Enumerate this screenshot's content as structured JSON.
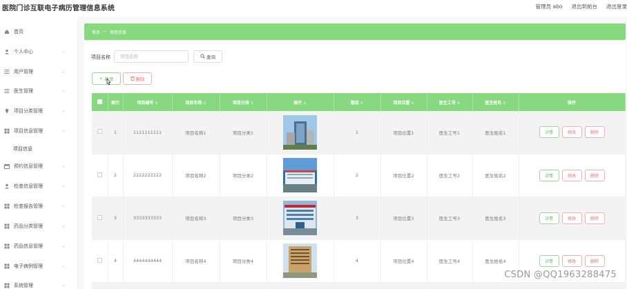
{
  "header": {
    "title": "医院门诊互联电子病历管理信息系统",
    "admin_label": "管理员 abo",
    "back_front_label": "退出到前台",
    "logout_label": "退出登录"
  },
  "sidebar": {
    "items": [
      {
        "label": "首页",
        "icon": "home-icon"
      },
      {
        "label": "个人中心",
        "icon": "user-icon"
      },
      {
        "label": "用户管理",
        "icon": "list-icon"
      },
      {
        "label": "医生管理",
        "icon": "list-icon"
      },
      {
        "label": "项目分类管理",
        "icon": "pin-icon"
      },
      {
        "label": "项目信息管理",
        "icon": "grid-icon"
      },
      {
        "label": "预约信息管理",
        "icon": "calendar-icon"
      },
      {
        "label": "检查信息管理",
        "icon": "user-icon"
      },
      {
        "label": "检查报告管理",
        "icon": "grid-icon"
      },
      {
        "label": "药品分类管理",
        "icon": "grid-icon"
      },
      {
        "label": "药品信息管理",
        "icon": "grid-icon"
      },
      {
        "label": "电子病例管理",
        "icon": "grid-icon"
      },
      {
        "label": "系统管理",
        "icon": "grid-icon"
      }
    ],
    "sub_item": "项目信息"
  },
  "breadcrumb": {
    "home": "首页",
    "separator": "—",
    "current": "项目信息"
  },
  "search": {
    "label": "项目名称",
    "placeholder": "项目名称",
    "button_label": "查询"
  },
  "toolbar": {
    "add_label": "新增",
    "delete_label": "删除"
  },
  "table": {
    "columns": [
      "索引",
      "项目编号",
      "项目名称",
      "项目分类",
      "图片",
      "楼层",
      "项目位置",
      "医生工号",
      "医生姓名",
      "操作"
    ],
    "rows": [
      {
        "index": "1",
        "code": "1111111111",
        "name": "项目名称1",
        "category": "项目分类1",
        "floor": "1",
        "location": "项目位置1",
        "doctor_id": "医生工号1",
        "doctor_name": "医生姓名1"
      },
      {
        "index": "2",
        "code": "2222222222",
        "name": "项目名称2",
        "category": "项目分类2",
        "floor": "2",
        "location": "项目位置2",
        "doctor_id": "医生工号2",
        "doctor_name": "医生姓名2"
      },
      {
        "index": "3",
        "code": "3333333333",
        "name": "项目名称3",
        "category": "项目分类3",
        "floor": "3",
        "location": "项目位置3",
        "doctor_id": "医生工号3",
        "doctor_name": "医生姓名3"
      },
      {
        "index": "4",
        "code": "4444444444",
        "name": "项目名称4",
        "category": "项目分类4",
        "floor": "4",
        "location": "项目位置4",
        "doctor_id": "医生工号4",
        "doctor_name": "医生姓名4"
      }
    ],
    "actions": {
      "detail": "详情",
      "edit": "修改",
      "remove": "删除"
    }
  },
  "watermark": "CSDN @QQ1963288475",
  "colors": {
    "accent": "#87d97f",
    "danger": "#e27575",
    "success": "#6abf69"
  }
}
